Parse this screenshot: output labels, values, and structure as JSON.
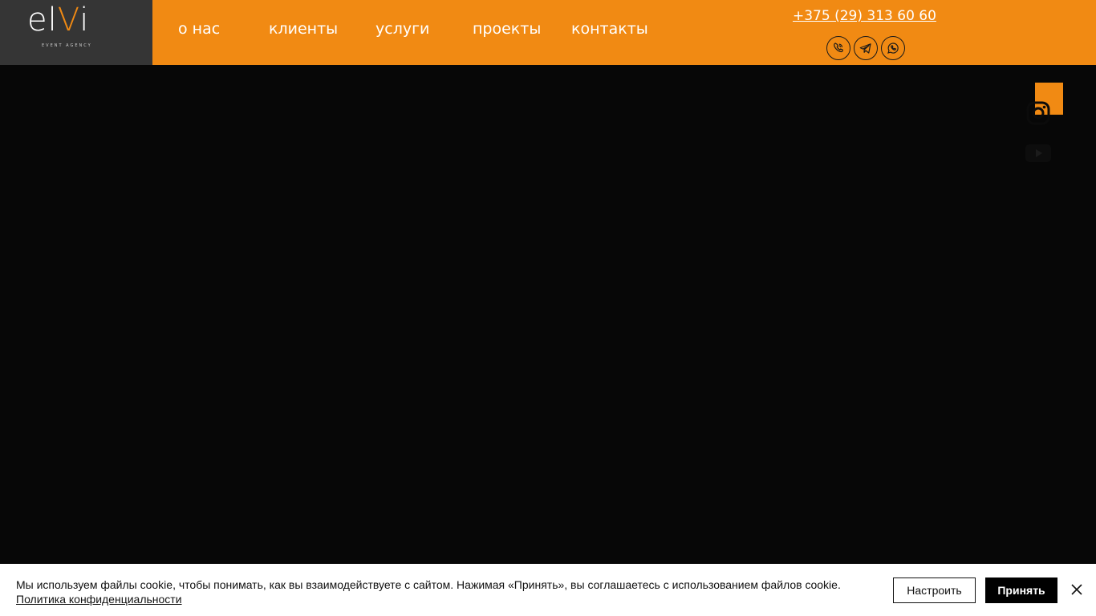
{
  "brand": {
    "logo_main": "el",
    "logo_accent": "V",
    "logo_end": "i",
    "logo_sub": "EVENT AGENCY"
  },
  "nav": {
    "items": [
      {
        "label": "о нас"
      },
      {
        "label": "клиенты"
      },
      {
        "label": "услуги"
      },
      {
        "label": "проекты"
      },
      {
        "label": "контакты"
      }
    ]
  },
  "contacts": {
    "phone": "+375 (29) 313 60 60",
    "messengers": [
      "viber-icon",
      "telegram-icon",
      "whatsapp-icon"
    ]
  },
  "social": {
    "icons": [
      "instagram-icon",
      "youtube-icon"
    ]
  },
  "cookie": {
    "text": "Мы используем файлы cookie, чтобы понимать, как вы взаимодействуете с сайтом. Нажимая «Принять», вы соглашаетесь с использованием файлов cookie.",
    "policy_link": "Политика конфиденциальности",
    "settings_label": "Настроить",
    "accept_label": "Принять"
  },
  "colors": {
    "accent": "#f18a13",
    "logo_bg": "#353535",
    "hero_bg": "#070707"
  }
}
